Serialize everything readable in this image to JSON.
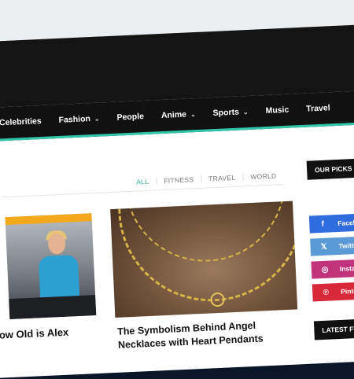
{
  "nav": {
    "items": [
      {
        "label": "Celebrities",
        "dropdown": false
      },
      {
        "label": "Fashion",
        "dropdown": true
      },
      {
        "label": "People",
        "dropdown": false
      },
      {
        "label": "Anime",
        "dropdown": true
      },
      {
        "label": "Sports",
        "dropdown": true
      },
      {
        "label": "Music",
        "dropdown": false
      },
      {
        "label": "Travel",
        "dropdown": false
      }
    ],
    "caret": "⌄",
    "accent": "#2fc7a8"
  },
  "filters": {
    "items": [
      "ALL",
      "FITNESS",
      "TRAVEL",
      "WORLD"
    ],
    "active": "ALL"
  },
  "posts": [
    {
      "title": "ar: How Old is Alex"
    },
    {
      "title": "The Symbolism Behind Angel Necklaces with Heart Pendants"
    }
  ],
  "sidebar": {
    "our_picks": "OUR PICKS",
    "latest": "LATEST FUN",
    "social": [
      {
        "label": "Faceboo",
        "icon": "facebook-icon",
        "glyph": "f",
        "color": "#2f6dde"
      },
      {
        "label": "Twitter",
        "icon": "x-icon",
        "glyph": "𝕏",
        "color": "#5a9ad6"
      },
      {
        "label": "Instagra",
        "icon": "instagram-icon",
        "glyph": "◎",
        "color": "#c1337a"
      },
      {
        "label": "Pintere",
        "icon": "pinterest-icon",
        "glyph": "℗",
        "color": "#d8293a"
      }
    ]
  }
}
